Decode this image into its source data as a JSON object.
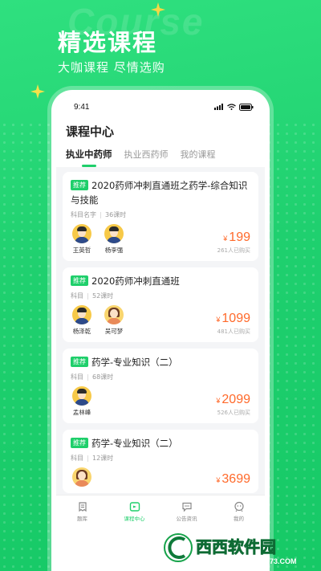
{
  "promo": {
    "bg_word": "Course",
    "title": "精选课程",
    "subtitle": "大咖课程 尽情选购"
  },
  "status_bar": {
    "time": "9:41"
  },
  "page": {
    "title": "课程中心",
    "tabs": [
      {
        "label": "执业中药师",
        "active": true
      },
      {
        "label": "执业西药师",
        "active": false
      },
      {
        "label": "我的课程",
        "active": false
      }
    ]
  },
  "courses": [
    {
      "tag": "推荐",
      "title": "2020药师冲刺直通班之药学-综合知识与技能",
      "subject": "科目名字",
      "hours": "36课时",
      "teachers": [
        "王英哲",
        "杨李强"
      ],
      "price_symbol": "¥",
      "price": "199",
      "buyers": "261人已购买"
    },
    {
      "tag": "推荐",
      "title": "2020药师冲刺直通班",
      "subject": "科目",
      "hours": "52课时",
      "teachers": [
        "杨泽乾",
        "吴可梦"
      ],
      "price_symbol": "¥",
      "price": "1099",
      "buyers": "481人已购买"
    },
    {
      "tag": "推荐",
      "title": "药学-专业知识（二）",
      "subject": "科目",
      "hours": "68课时",
      "teachers": [
        "孟林峰"
      ],
      "price_symbol": "¥",
      "price": "2099",
      "buyers": "526人已购买"
    },
    {
      "tag": "推荐",
      "title": "药学-专业知识（二）",
      "subject": "科目",
      "hours": "12课时",
      "teachers": [
        ""
      ],
      "price_symbol": "¥",
      "price": "3699",
      "buyers": ""
    }
  ],
  "tabbar": [
    {
      "label": "题库",
      "icon": "question-bank-icon",
      "active": false
    },
    {
      "label": "课程中心",
      "icon": "course-center-icon",
      "active": true
    },
    {
      "label": "公告资讯",
      "icon": "announcement-icon",
      "active": false
    },
    {
      "label": "我的",
      "icon": "profile-icon",
      "active": false
    }
  ],
  "watermark": {
    "brand": "西西软件园",
    "url": "CR173.COM"
  },
  "colors": {
    "accent": "#1fcf6b",
    "price": "#ff6a2b",
    "background": "#21d372"
  }
}
